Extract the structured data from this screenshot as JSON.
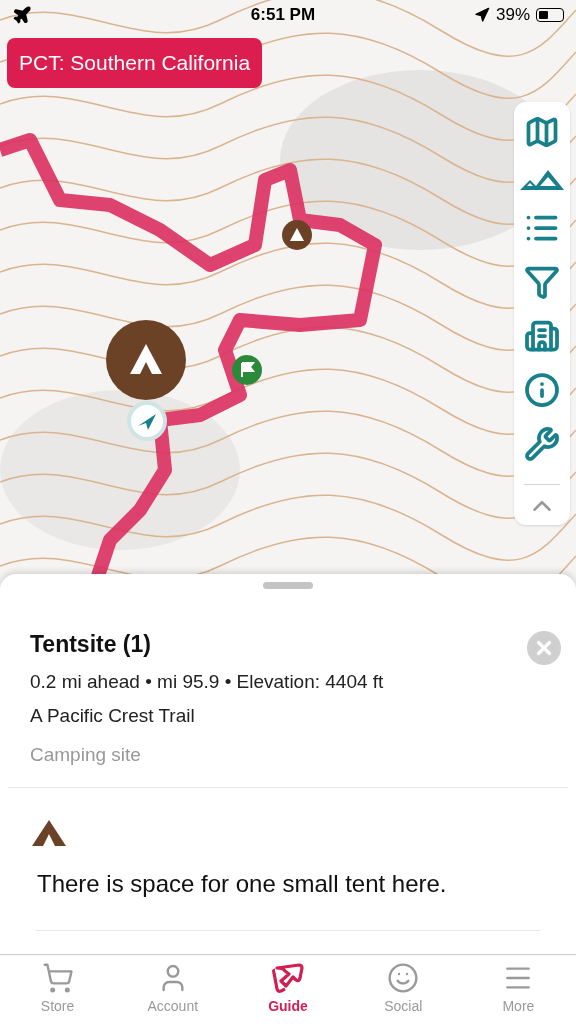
{
  "status_bar": {
    "time": "6:51 PM",
    "battery": "39%"
  },
  "map": {
    "title": "PCT: Southern California"
  },
  "map_tools": [
    {
      "kind": "map"
    },
    {
      "kind": "mountains"
    },
    {
      "kind": "list"
    },
    {
      "kind": "filter"
    },
    {
      "kind": "buildings"
    },
    {
      "kind": "info"
    },
    {
      "kind": "tools"
    }
  ],
  "sheet": {
    "title": "Tentsite (1)",
    "meta": "0.2 mi ahead • mi 95.9 • Elevation: 4404 ft",
    "trail": "A Pacific Crest Trail",
    "category": "Camping site",
    "description": "There is space for one small tent here."
  },
  "tabs": [
    {
      "label": "Store",
      "kind": "cart",
      "selected": false
    },
    {
      "label": "Account",
      "kind": "person",
      "selected": false
    },
    {
      "label": "Guide",
      "kind": "guide",
      "selected": true
    },
    {
      "label": "Social",
      "kind": "smile",
      "selected": false
    },
    {
      "label": "More",
      "kind": "menu",
      "selected": false
    }
  ]
}
